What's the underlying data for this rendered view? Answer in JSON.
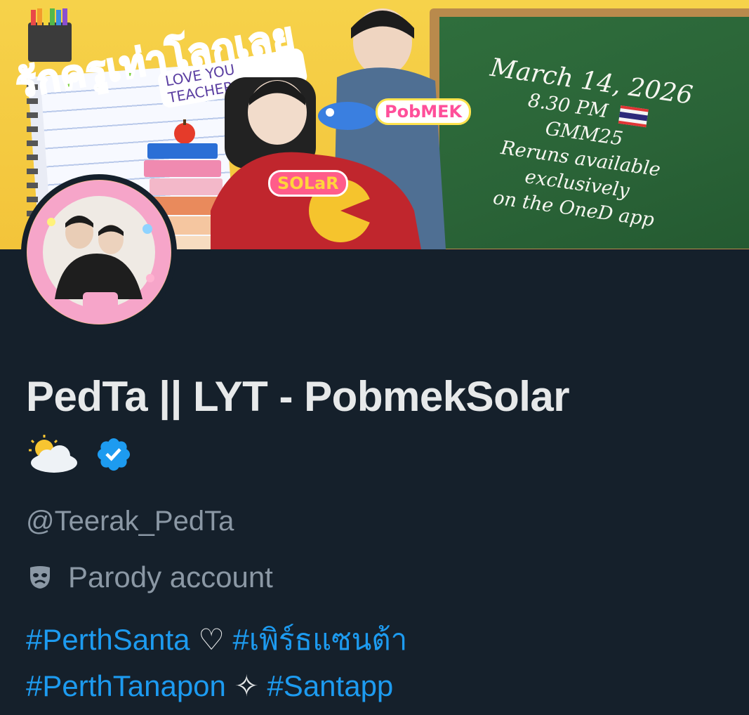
{
  "banner": {
    "title_thai": "รักครูเท่าโลกเลย",
    "title_english": "LOVE YOU TEACHER",
    "sticker_pobmek": "PobMEK",
    "sticker_solar": "SOLaR",
    "chalkboard": {
      "date": "March 14, 2026",
      "time": "8.30 PM",
      "channel": "GMM25",
      "line1": "Reruns available exclusively",
      "line2": "on the OneD app"
    }
  },
  "profile": {
    "name": "PedTa || LYT - PobmekSolar",
    "name_emoji": "⛅",
    "verified_icon": "verified-badge-icon",
    "handle": "@Teerak_PedTa",
    "parody_label": "Parody account",
    "parody_icon": "theater-mask-icon"
  },
  "bio": {
    "tag1": "#PerthSanta",
    "sep1": "♡",
    "tag2": "#เพิร์ธแซนต้า",
    "tag3": "#PerthTanapon",
    "sep2": "✧",
    "tag4": "#Santapp"
  },
  "colors": {
    "background": "#15202b",
    "link": "#1d9bf0",
    "muted": "#8b98a5",
    "text": "#e7e9ea",
    "verified": "#1d9bf0"
  }
}
